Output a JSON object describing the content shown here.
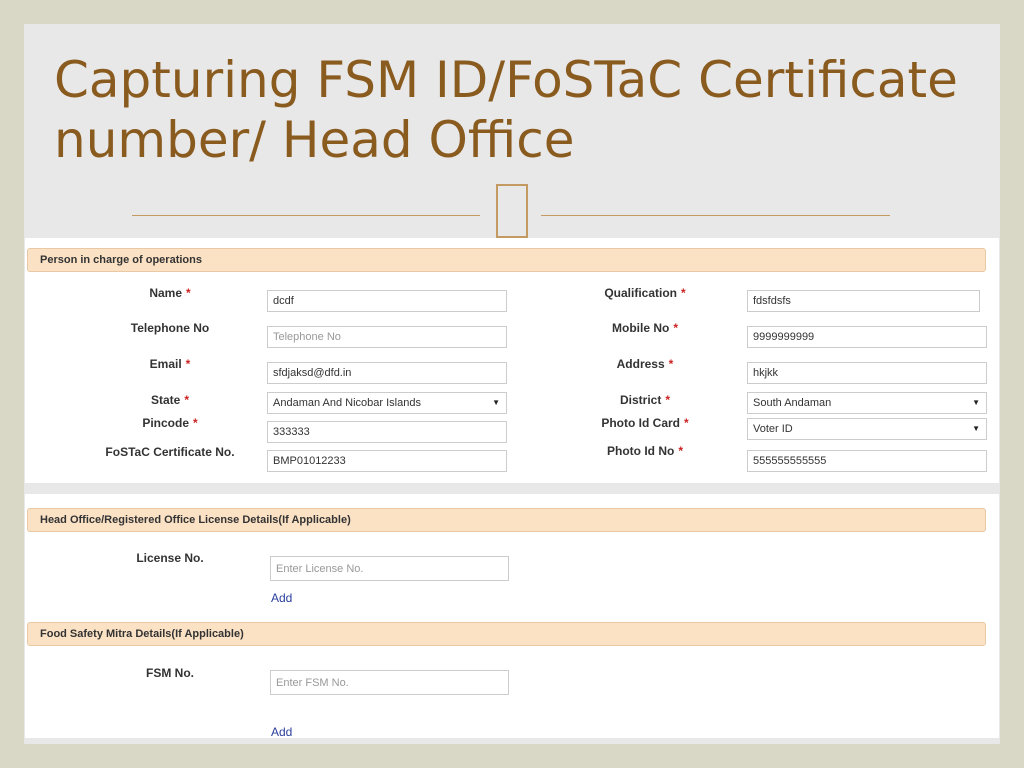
{
  "slide": {
    "title": "Capturing FSM ID/FoSTaC Certificate number/ Head Office"
  },
  "person_section": {
    "header": "Person in charge of operations",
    "required_mark": "*",
    "fields": {
      "name": {
        "label": "Name",
        "value": "dcdf"
      },
      "qualification": {
        "label": "Qualification",
        "value": "fdsfdsfs"
      },
      "telephone": {
        "label": "Telephone No",
        "placeholder": "Telephone No",
        "value": ""
      },
      "mobile": {
        "label": "Mobile No",
        "value": "9999999999"
      },
      "email": {
        "label": "Email",
        "value": "sfdjaksd@dfd.in"
      },
      "address": {
        "label": "Address",
        "value": "hkjkk"
      },
      "state": {
        "label": "State",
        "selected": "Andaman And Nicobar Islands"
      },
      "district": {
        "label": "District",
        "selected": "South Andaman"
      },
      "pincode": {
        "label": "Pincode",
        "value": "333333"
      },
      "photo_id_card": {
        "label": "Photo Id Card",
        "selected": "Voter ID"
      },
      "fostac": {
        "label": "FoSTaC Certificate No.",
        "value": "BMP01012233"
      },
      "photo_id_no": {
        "label": "Photo Id No",
        "value": "555555555555"
      }
    }
  },
  "head_office_section": {
    "header": "Head Office/Registered Office License Details(If Applicable)",
    "license_label": "License No.",
    "license_placeholder": "Enter License No.",
    "add_label": "Add"
  },
  "fsm_section": {
    "header": "Food Safety Mitra Details(If Applicable)",
    "fsm_label": "FSM No.",
    "fsm_placeholder": "Enter FSM No.",
    "add_label": "Add"
  },
  "icons": {
    "select_caret": "▼"
  }
}
